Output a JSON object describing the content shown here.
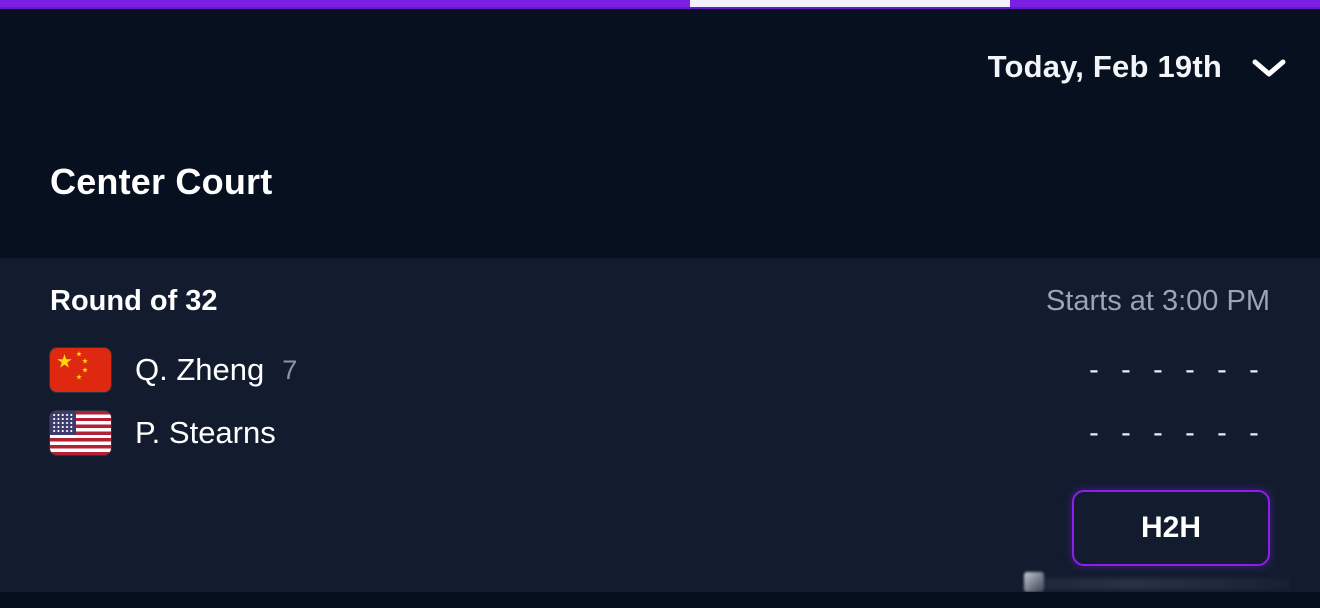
{
  "topbar": {
    "segments": [
      {
        "name": "segment-1",
        "state": "inactive"
      },
      {
        "name": "segment-2",
        "state": "active"
      },
      {
        "name": "segment-3",
        "state": "inactive"
      }
    ],
    "purple_color": "#7b1fe0",
    "active_color": "#f2f0fb"
  },
  "header": {
    "date_label": "Today, Feb 19th",
    "date_chevron": "chevron-down-icon",
    "court_title": "Center Court",
    "background": "#06101f"
  },
  "match": {
    "round": "Round of 32",
    "status": "Starts at 3:00 PM",
    "card_background": "#121c2e",
    "players": [
      {
        "flag": "cn",
        "flag_name": "flag-china",
        "name": "Q. Zheng",
        "seed": "7",
        "scores": [
          "-",
          "-",
          "-",
          "-",
          "-",
          "-"
        ]
      },
      {
        "flag": "us",
        "flag_name": "flag-usa",
        "name": "P. Stearns",
        "seed": "",
        "scores": [
          "-",
          "-",
          "-",
          "-",
          "-",
          "-"
        ]
      }
    ],
    "h2h_label": "H2H",
    "h2h_accent": "#8b1ff0"
  }
}
